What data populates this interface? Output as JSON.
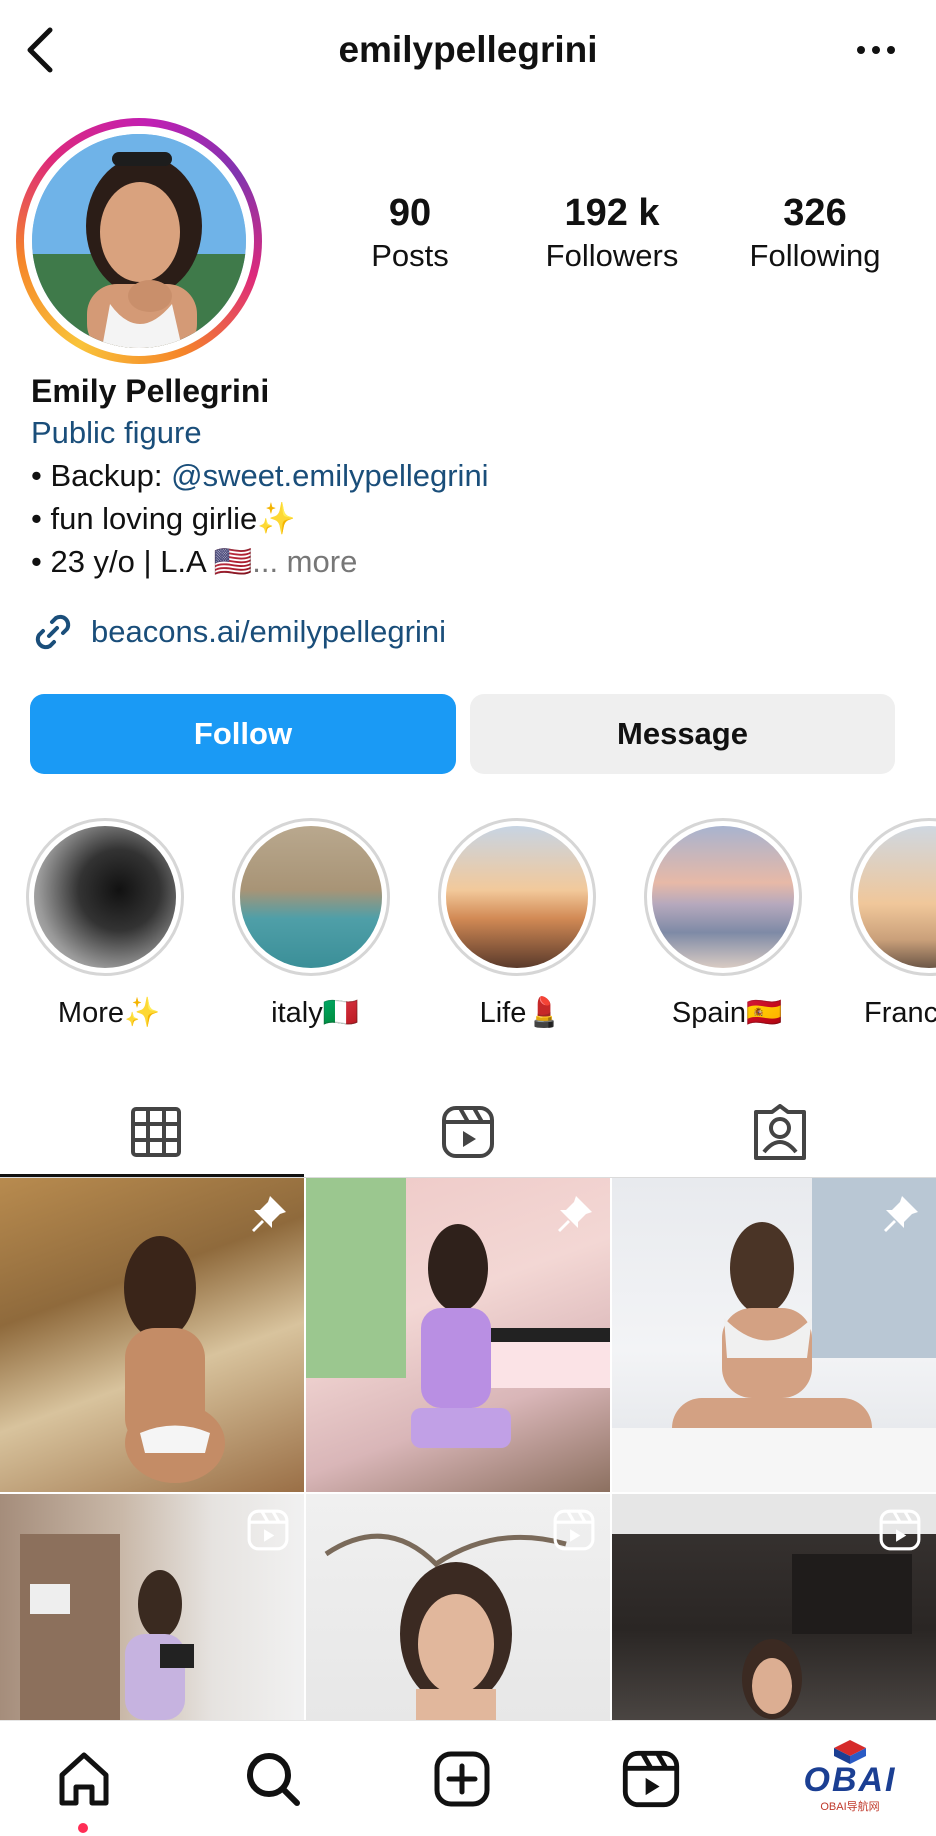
{
  "header": {
    "username": "emilypellegrini",
    "back_icon": "chevron-left-icon",
    "more_icon": "more-horizontal-icon"
  },
  "profile": {
    "avatar_icon": "profile-photo",
    "stats": [
      {
        "value": "90",
        "label": "Posts"
      },
      {
        "value": "192 k",
        "label": "Followers"
      },
      {
        "value": "326",
        "label": "Following"
      }
    ],
    "name": "Emily Pellegrini",
    "category": "Public figure",
    "bio": {
      "line1_prefix": "• Backup: ",
      "line1_handle": "@sweet.emilypellegrini",
      "line2": "• fun loving girlie✨",
      "line3": "• 23 y/o | L.A 🇺🇸",
      "more": "... more"
    },
    "website": "beacons.ai/emilypellegrini",
    "link_icon": "link-icon"
  },
  "actions": {
    "follow_label": "Follow",
    "message_label": "Message",
    "follow_color": "#1a9af5"
  },
  "highlights": [
    {
      "label": "More✨"
    },
    {
      "label": "italy🇮🇹"
    },
    {
      "label": "Life💄"
    },
    {
      "label": "Spain🇪🇸"
    },
    {
      "label": "Franc"
    }
  ],
  "tabs": [
    {
      "icon": "grid-icon"
    },
    {
      "icon": "reels-icon"
    },
    {
      "icon": "tagged-icon"
    }
  ],
  "posts": [
    {
      "badge": "pin-icon"
    },
    {
      "badge": "pin-icon"
    },
    {
      "badge": "pin-icon"
    },
    {
      "badge": "reel-icon"
    },
    {
      "badge": "reel-icon"
    },
    {
      "badge": "reel-icon"
    }
  ],
  "bottom_nav": [
    {
      "icon": "home-icon"
    },
    {
      "icon": "search-icon"
    },
    {
      "icon": "create-icon"
    },
    {
      "icon": "reels-icon"
    }
  ],
  "watermark": {
    "big": "OBAI",
    "small": "OBAI导航网"
  }
}
